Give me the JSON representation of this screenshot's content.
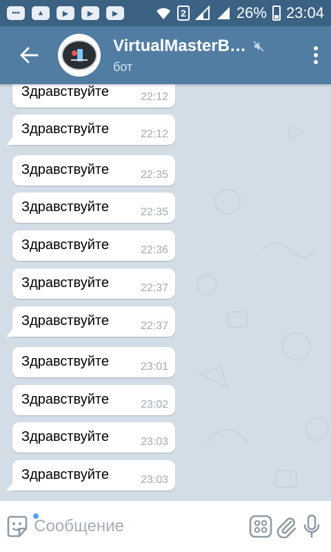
{
  "status_bar": {
    "sim_slot": "2",
    "battery": "26%",
    "time": "23:04"
  },
  "header": {
    "title": "VirtualMasterB…",
    "subtitle": "бот",
    "muted": true
  },
  "messages": [
    {
      "text": "Здравствуйте",
      "time": "22:12"
    },
    {
      "text": "Здравствуйте",
      "time": "22:12"
    },
    {
      "text": "Здравствуйте",
      "time": "22:35"
    },
    {
      "text": "Здравствуйте",
      "time": "22:35"
    },
    {
      "text": "Здравствуйте",
      "time": "22:36"
    },
    {
      "text": "Здравствуйте",
      "time": "22:37"
    },
    {
      "text": "Здравствуйте",
      "time": "22:37"
    },
    {
      "text": "Здравствуйте",
      "time": "23:01"
    },
    {
      "text": "Здравствуйте",
      "time": "23:02"
    },
    {
      "text": "Здравствуйте",
      "time": "23:03"
    },
    {
      "text": "Здравствуйте",
      "time": "23:03"
    }
  ],
  "compose": {
    "placeholder": "Сообщение"
  },
  "colors": {
    "status_bar": "#3b6183",
    "header": "#517da2",
    "chat_background": "#d3dde6",
    "bubble": "#ffffff",
    "time_text": "#a1aab3",
    "emoji_badge": "#4ea4f6"
  }
}
